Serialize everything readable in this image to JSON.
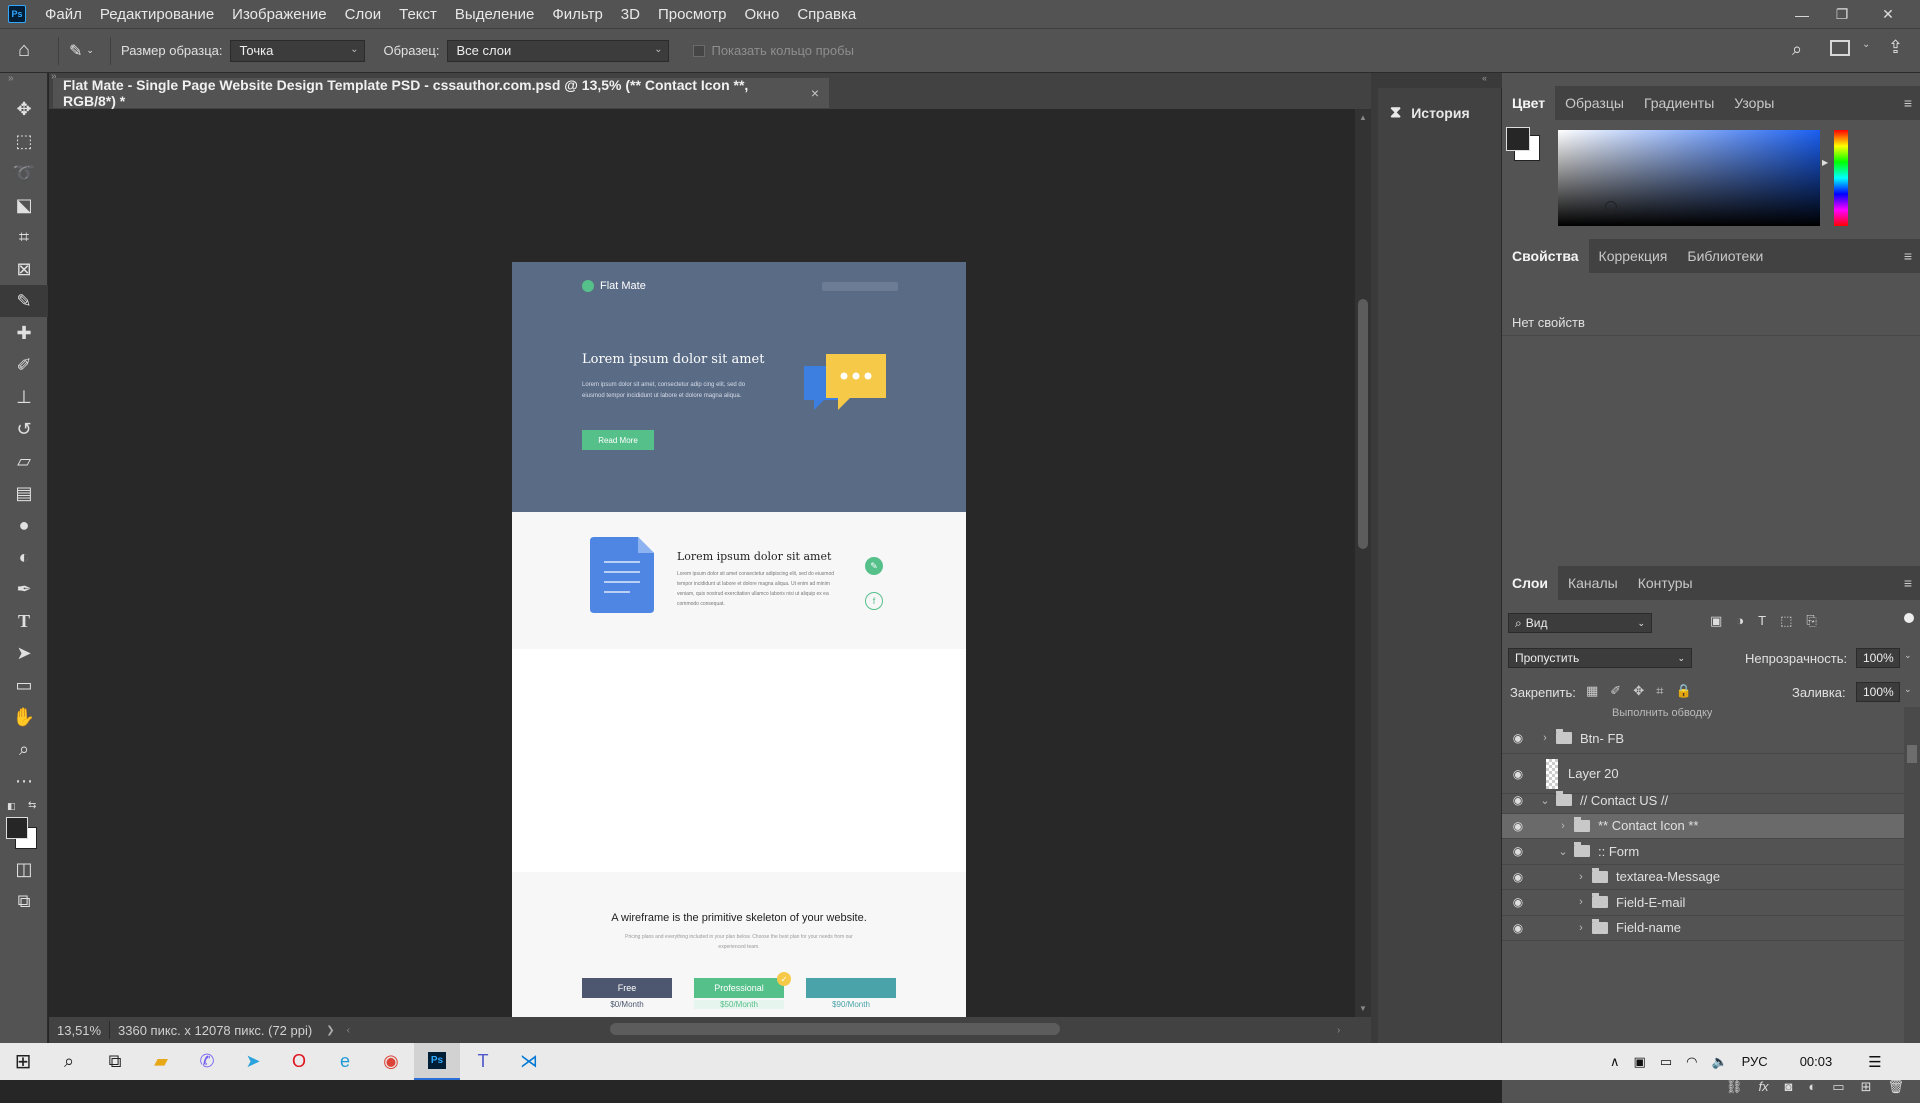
{
  "menubar": {
    "items": [
      "Файл",
      "Редактирование",
      "Изображение",
      "Слои",
      "Текст",
      "Выделение",
      "Фильтр",
      "3D",
      "Просмотр",
      "Окно",
      "Справка"
    ],
    "app_logo": "Ps"
  },
  "optbar": {
    "sample_size_label": "Размер образца:",
    "sample_size_value": "Точка",
    "sample_label": "Образец:",
    "sample_value": "Все слои",
    "show_ring_label": "Показать кольцо пробы"
  },
  "document": {
    "tab_title": "Flat Mate - Single Page Website Design Template PSD - cssauthor.com.psd @ 13,5% (** Contact Icon **, RGB/8*) *",
    "close_glyph": "×"
  },
  "statusbar": {
    "zoom": "13,51%",
    "dimensions": "3360 пикс. x 12078 пикс. (72 ppi)",
    "arrow": "❯"
  },
  "design": {
    "brand": "Flat Mate",
    "hero_title": "Lorem ipsum dolor sit amet",
    "hero_text": "Lorem ipsum dolor sit amet, consectetur adip cing elit, sed do eiusmod tempor incididunt ut labore et dolore magna aliqua.",
    "hero_button": "Read More",
    "feature_title": "Lorem ipsum dolor sit amet",
    "feature_text": "Lorem ipsum dolor sit amet consectetur adipiscing elit, sed do eiusmod tempor incididunt ut labore et dolore magna aliqua. Ut enim ad minim veniam, quis nostrud exercitation ullamco laboris nisi ut aliquip ex ea commodo consequat.",
    "pricing_title": "A wireframe is the primitive skeleton of your website.",
    "pricing_text": "Pricing plans and everything included in your plan below. Choose the best plan for your needs from our experienced team.",
    "plans": [
      {
        "name": "Free",
        "price": "$0/Month",
        "color": "#4d5870"
      },
      {
        "name": "Professional",
        "price": "$50/Month",
        "color": "#56c08b"
      },
      {
        "name": "",
        "price": "$90/Month",
        "color": "#4aa3a8"
      }
    ]
  },
  "history": {
    "label": "История"
  },
  "color_panel": {
    "tabs": [
      "Цвет",
      "Образцы",
      "Градиенты",
      "Узоры"
    ]
  },
  "properties_panel": {
    "tabs": [
      "Свойства",
      "Коррекция",
      "Библиотеки"
    ],
    "empty_text": "Нет свойств"
  },
  "layers_panel": {
    "tabs": [
      "Слои",
      "Каналы",
      "Контуры"
    ],
    "filter_value": "Вид",
    "blend_mode": "Пропустить",
    "opacity_label": "Непрозрачность:",
    "opacity_value": "100%",
    "lock_label": "Закрепить:",
    "fill_label": "Заливка:",
    "fill_value": "100%",
    "partial_row": "Выполнить обводку",
    "layers": [
      {
        "name": "Btn- FB",
        "kind": "folder",
        "indent": 0,
        "caret": "›",
        "selected": false
      },
      {
        "name": "Layer 20",
        "kind": "pixel",
        "indent": 0,
        "caret": "",
        "selected": false
      },
      {
        "name": "// Contact US //",
        "kind": "folder",
        "indent": 0,
        "caret": "⌄",
        "selected": false
      },
      {
        "name": "** Contact Icon **",
        "kind": "folder",
        "indent": 1,
        "caret": "›",
        "selected": true
      },
      {
        "name": ":: Form",
        "kind": "folder",
        "indent": 1,
        "caret": "⌄",
        "selected": false
      },
      {
        "name": "textarea-Message",
        "kind": "folder",
        "indent": 2,
        "caret": "›",
        "selected": false
      },
      {
        "name": "Field-E-mail",
        "kind": "folder",
        "indent": 2,
        "caret": "›",
        "selected": false
      },
      {
        "name": "Field-name",
        "kind": "folder",
        "indent": 2,
        "caret": "›",
        "selected": false
      }
    ]
  },
  "taskbar": {
    "lang": "РУС",
    "time": "00:03"
  },
  "colors": {
    "accent_green": "#56c08b",
    "hero_blue": "#5a6b86",
    "ps_panel": "#535353"
  }
}
